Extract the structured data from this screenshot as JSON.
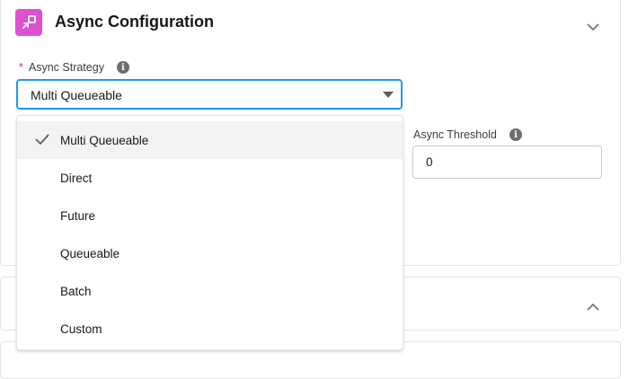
{
  "section": {
    "title": "Async Configuration",
    "icon": "async-config-icon",
    "accent": "#dd50d2"
  },
  "strategy": {
    "required_marker": "*",
    "label": "Async Strategy",
    "value": "Multi Queueable",
    "options": [
      {
        "label": "Multi Queueable",
        "selected": true
      },
      {
        "label": "Direct",
        "selected": false
      },
      {
        "label": "Future",
        "selected": false
      },
      {
        "label": "Queueable",
        "selected": false
      },
      {
        "label": "Batch",
        "selected": false
      },
      {
        "label": "Custom",
        "selected": false
      }
    ]
  },
  "threshold": {
    "label": "Async Threshold",
    "value": "0"
  },
  "info_glyph": "i",
  "colors": {
    "focus_border": "#1b96ff",
    "required": "#c23934"
  }
}
